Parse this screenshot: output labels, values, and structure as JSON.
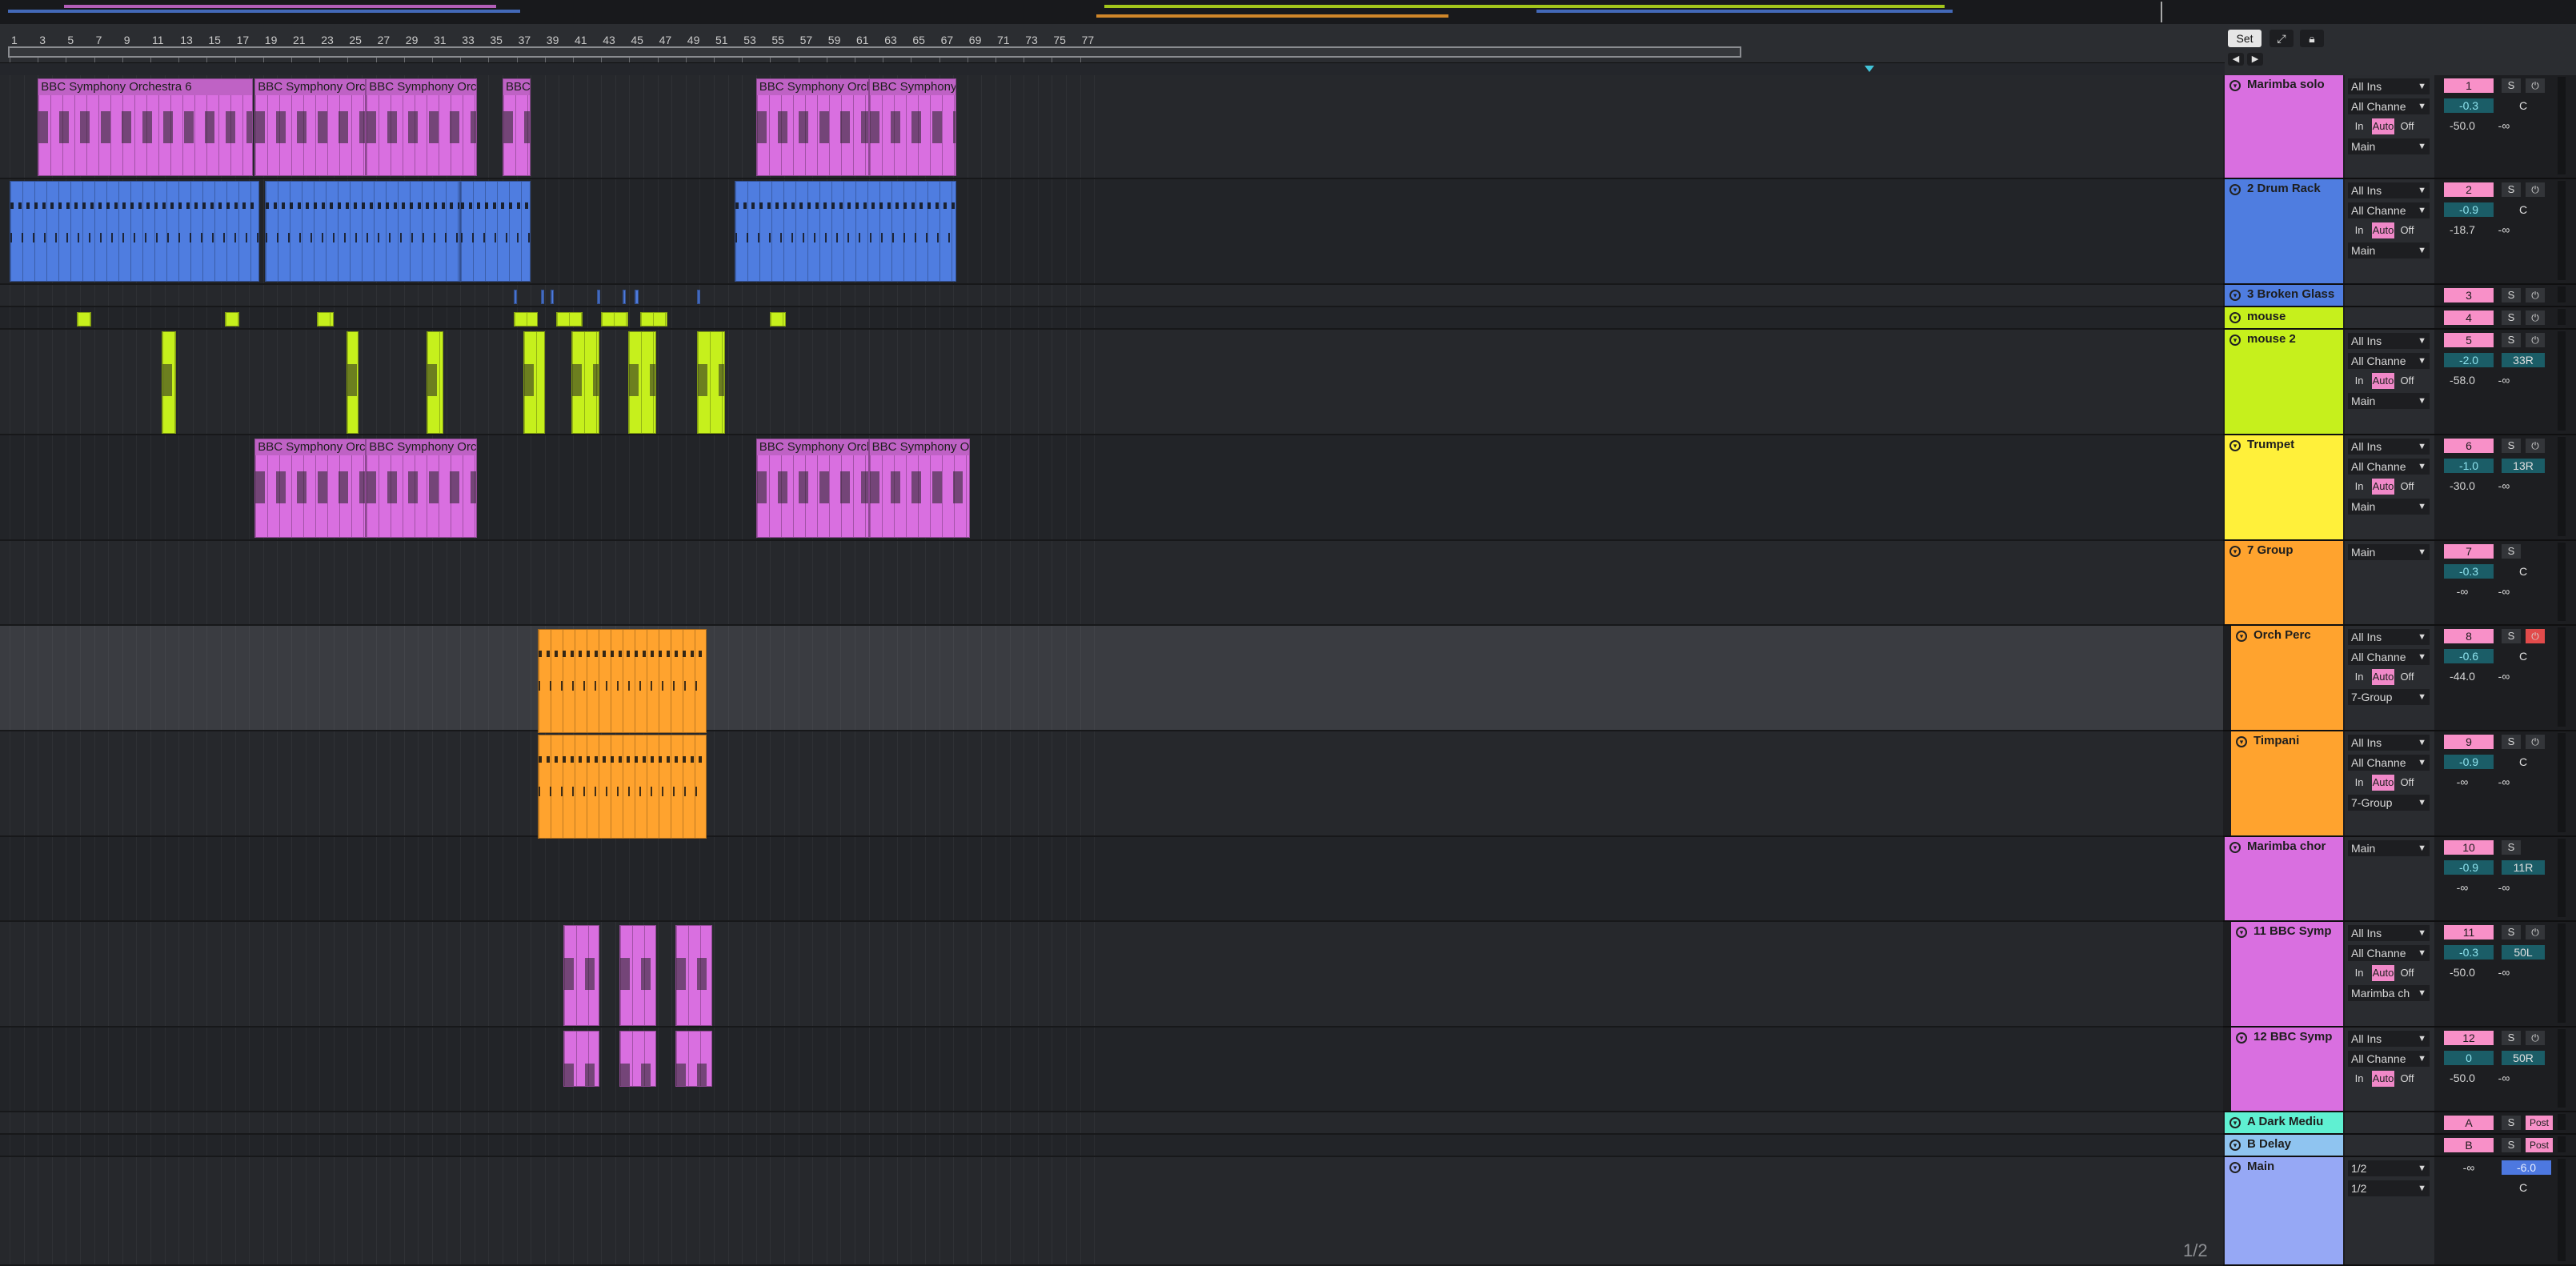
{
  "ruler": {
    "bars": [
      "1",
      "3",
      "5",
      "7",
      "9",
      "11",
      "13",
      "15",
      "17",
      "19",
      "21",
      "23",
      "25",
      "27",
      "29",
      "31",
      "33",
      "35",
      "37",
      "39",
      "41",
      "43",
      "45",
      "47",
      "49",
      "51",
      "53",
      "55",
      "57",
      "59",
      "61",
      "63",
      "65",
      "67",
      "69",
      "71",
      "73",
      "75",
      "77"
    ]
  },
  "controls": {
    "set_label": "Set",
    "fit_icon": "expand-icon",
    "lock_icon": "lock-icon"
  },
  "clip_label": "BBC Symphony Orchestra 6",
  "clip_label_short": "BBC Symp",
  "tracks": [
    {
      "name": "Marimba solo",
      "color": "#d96fe0",
      "input": "All Ins",
      "channel": "All Channe",
      "monitor": [
        "In",
        "Auto",
        "Off"
      ],
      "output": "Main",
      "number": "1",
      "volume": "-0.3",
      "pan": "C",
      "send_a": "-50.0",
      "send_b": "-∞"
    },
    {
      "name": "2 Drum Rack",
      "color": "#4f7de0",
      "input": "All Ins",
      "channel": "All Channe",
      "monitor": [
        "In",
        "Auto",
        "Off"
      ],
      "output": "Main",
      "number": "2",
      "volume": "-0.9",
      "pan": "C",
      "send_a": "-18.7",
      "send_b": "-∞"
    },
    {
      "name": "3 Broken Glass",
      "color": "#4f7de0",
      "number": "3"
    },
    {
      "name": "mouse",
      "color": "#c6f01c",
      "number": "4"
    },
    {
      "name": "mouse 2",
      "color": "#c6f01c",
      "input": "All Ins",
      "channel": "All Channe",
      "monitor": [
        "In",
        "Auto",
        "Off"
      ],
      "output": "Main",
      "number": "5",
      "volume": "-2.0",
      "pan": "33R",
      "send_a": "-58.0",
      "send_b": "-∞"
    },
    {
      "name": "Trumpet",
      "color": "#fff03a",
      "input": "All Ins",
      "channel": "All Channe",
      "monitor": [
        "In",
        "Auto",
        "Off"
      ],
      "output": "Main",
      "number": "6",
      "volume": "-1.0",
      "pan": "13R",
      "send_a": "-30.0",
      "send_b": "-∞"
    },
    {
      "name": "7 Group",
      "color": "#ffa32e",
      "output": "Main",
      "number": "7",
      "volume": "-0.3",
      "pan": "C",
      "send_a": "-∞",
      "send_b": "-∞"
    },
    {
      "name": "Orch Perc",
      "color": "#ffa32e",
      "input": "All Ins",
      "channel": "All Channe",
      "monitor": [
        "In",
        "Auto",
        "Off"
      ],
      "output": "7-Group",
      "number": "8",
      "volume": "-0.6",
      "pan": "C",
      "send_a": "-44.0",
      "send_b": "-∞"
    },
    {
      "name": "Timpani",
      "color": "#ffa32e",
      "input": "All Ins",
      "channel": "All Channe",
      "monitor": [
        "In",
        "Auto",
        "Off"
      ],
      "output": "7-Group",
      "number": "9",
      "volume": "-0.9",
      "pan": "C",
      "send_a": "-∞",
      "send_b": "-∞"
    },
    {
      "name": "Marimba chor",
      "color": "#d96fe0",
      "output": "Main",
      "number": "10",
      "volume": "-0.9",
      "pan": "11R",
      "send_a": "-∞",
      "send_b": "-∞"
    },
    {
      "name": "11 BBC Symp",
      "color": "#d96fe0",
      "input": "All Ins",
      "channel": "All Channe",
      "monitor": [
        "In",
        "Auto",
        "Off"
      ],
      "output": "Marimba ch",
      "number": "11",
      "volume": "-0.3",
      "pan": "50L",
      "send_a": "-50.0",
      "send_b": "-∞"
    },
    {
      "name": "12 BBC Symp",
      "color": "#d96fe0",
      "input": "All Ins",
      "channel": "All Channe",
      "monitor": [
        "In",
        "Auto",
        "Off"
      ],
      "number": "12",
      "volume": "0",
      "pan": "50R",
      "send_a": "-50.0",
      "send_b": "-∞"
    },
    {
      "name": "A Dark Mediu",
      "color": "#5ff0d2",
      "number": "A",
      "post": "Post"
    },
    {
      "name": "B Delay",
      "color": "#8fc4f0",
      "number": "B",
      "post": "Post"
    },
    {
      "name": "Main",
      "color": "#96a8f5",
      "number": "",
      "input": "1/2",
      "output": "1/2",
      "send_a": "-∞",
      "volume": "-6.0",
      "pan": "C"
    }
  ],
  "page_indicator": "1/2"
}
